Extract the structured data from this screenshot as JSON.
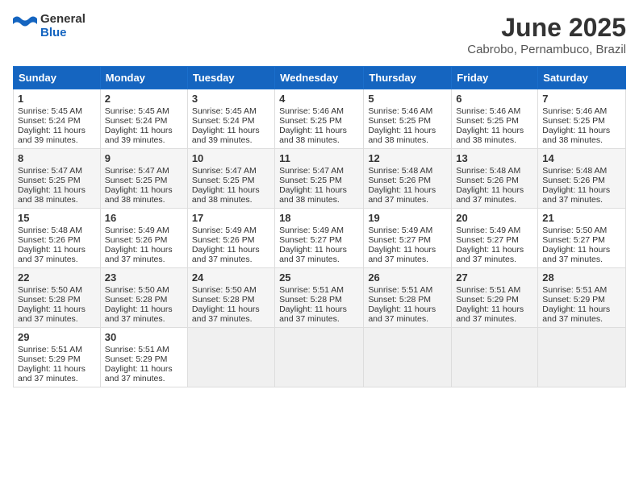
{
  "logo": {
    "general": "General",
    "blue": "Blue"
  },
  "title": "June 2025",
  "subtitle": "Cabrobo, Pernambuco, Brazil",
  "days_of_week": [
    "Sunday",
    "Monday",
    "Tuesday",
    "Wednesday",
    "Thursday",
    "Friday",
    "Saturday"
  ],
  "weeks": [
    [
      {
        "day": "1",
        "sunrise": "5:45 AM",
        "sunset": "5:24 PM",
        "daylight": "11 hours and 39 minutes."
      },
      {
        "day": "2",
        "sunrise": "5:45 AM",
        "sunset": "5:24 PM",
        "daylight": "11 hours and 39 minutes."
      },
      {
        "day": "3",
        "sunrise": "5:45 AM",
        "sunset": "5:24 PM",
        "daylight": "11 hours and 39 minutes."
      },
      {
        "day": "4",
        "sunrise": "5:46 AM",
        "sunset": "5:25 PM",
        "daylight": "11 hours and 38 minutes."
      },
      {
        "day": "5",
        "sunrise": "5:46 AM",
        "sunset": "5:25 PM",
        "daylight": "11 hours and 38 minutes."
      },
      {
        "day": "6",
        "sunrise": "5:46 AM",
        "sunset": "5:25 PM",
        "daylight": "11 hours and 38 minutes."
      },
      {
        "day": "7",
        "sunrise": "5:46 AM",
        "sunset": "5:25 PM",
        "daylight": "11 hours and 38 minutes."
      }
    ],
    [
      {
        "day": "8",
        "sunrise": "5:47 AM",
        "sunset": "5:25 PM",
        "daylight": "11 hours and 38 minutes."
      },
      {
        "day": "9",
        "sunrise": "5:47 AM",
        "sunset": "5:25 PM",
        "daylight": "11 hours and 38 minutes."
      },
      {
        "day": "10",
        "sunrise": "5:47 AM",
        "sunset": "5:25 PM",
        "daylight": "11 hours and 38 minutes."
      },
      {
        "day": "11",
        "sunrise": "5:47 AM",
        "sunset": "5:25 PM",
        "daylight": "11 hours and 38 minutes."
      },
      {
        "day": "12",
        "sunrise": "5:48 AM",
        "sunset": "5:26 PM",
        "daylight": "11 hours and 37 minutes."
      },
      {
        "day": "13",
        "sunrise": "5:48 AM",
        "sunset": "5:26 PM",
        "daylight": "11 hours and 37 minutes."
      },
      {
        "day": "14",
        "sunrise": "5:48 AM",
        "sunset": "5:26 PM",
        "daylight": "11 hours and 37 minutes."
      }
    ],
    [
      {
        "day": "15",
        "sunrise": "5:48 AM",
        "sunset": "5:26 PM",
        "daylight": "11 hours and 37 minutes."
      },
      {
        "day": "16",
        "sunrise": "5:49 AM",
        "sunset": "5:26 PM",
        "daylight": "11 hours and 37 minutes."
      },
      {
        "day": "17",
        "sunrise": "5:49 AM",
        "sunset": "5:26 PM",
        "daylight": "11 hours and 37 minutes."
      },
      {
        "day": "18",
        "sunrise": "5:49 AM",
        "sunset": "5:27 PM",
        "daylight": "11 hours and 37 minutes."
      },
      {
        "day": "19",
        "sunrise": "5:49 AM",
        "sunset": "5:27 PM",
        "daylight": "11 hours and 37 minutes."
      },
      {
        "day": "20",
        "sunrise": "5:49 AM",
        "sunset": "5:27 PM",
        "daylight": "11 hours and 37 minutes."
      },
      {
        "day": "21",
        "sunrise": "5:50 AM",
        "sunset": "5:27 PM",
        "daylight": "11 hours and 37 minutes."
      }
    ],
    [
      {
        "day": "22",
        "sunrise": "5:50 AM",
        "sunset": "5:28 PM",
        "daylight": "11 hours and 37 minutes."
      },
      {
        "day": "23",
        "sunrise": "5:50 AM",
        "sunset": "5:28 PM",
        "daylight": "11 hours and 37 minutes."
      },
      {
        "day": "24",
        "sunrise": "5:50 AM",
        "sunset": "5:28 PM",
        "daylight": "11 hours and 37 minutes."
      },
      {
        "day": "25",
        "sunrise": "5:51 AM",
        "sunset": "5:28 PM",
        "daylight": "11 hours and 37 minutes."
      },
      {
        "day": "26",
        "sunrise": "5:51 AM",
        "sunset": "5:28 PM",
        "daylight": "11 hours and 37 minutes."
      },
      {
        "day": "27",
        "sunrise": "5:51 AM",
        "sunset": "5:29 PM",
        "daylight": "11 hours and 37 minutes."
      },
      {
        "day": "28",
        "sunrise": "5:51 AM",
        "sunset": "5:29 PM",
        "daylight": "11 hours and 37 minutes."
      }
    ],
    [
      {
        "day": "29",
        "sunrise": "5:51 AM",
        "sunset": "5:29 PM",
        "daylight": "11 hours and 37 minutes."
      },
      {
        "day": "30",
        "sunrise": "5:51 AM",
        "sunset": "5:29 PM",
        "daylight": "11 hours and 37 minutes."
      },
      null,
      null,
      null,
      null,
      null
    ]
  ]
}
